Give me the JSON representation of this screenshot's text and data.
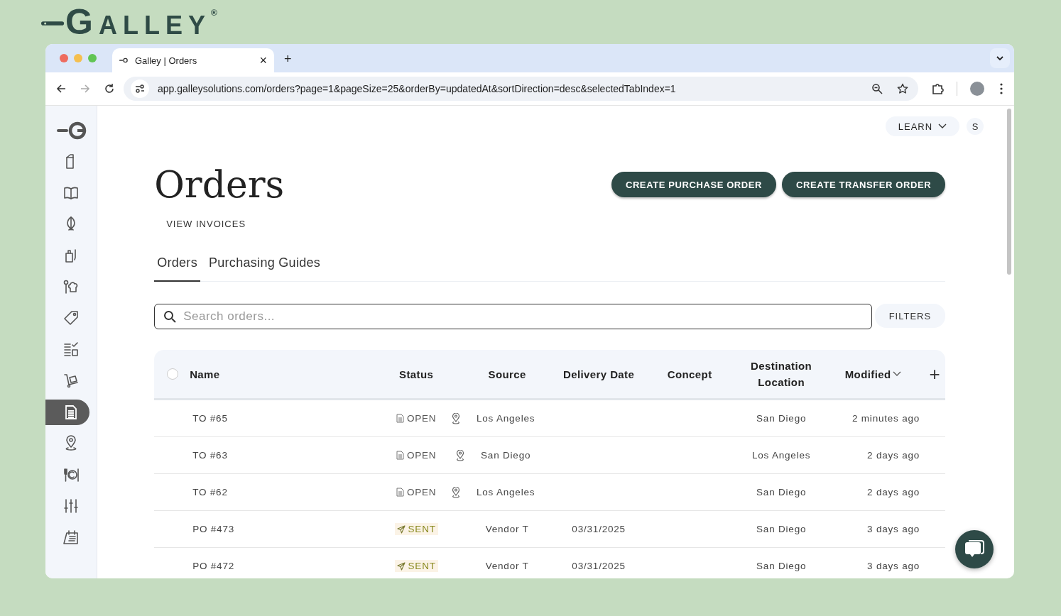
{
  "brand": {
    "text": "GALLEY",
    "mark": "®"
  },
  "browser": {
    "tab": {
      "title": "Galley | Orders",
      "close": "×"
    },
    "new_tab": "+",
    "url": "app.galleysolutions.com/orders?page=1&pageSize=25&orderBy=updatedAt&sortDirection=desc&selectedTabIndex=1"
  },
  "sidebar": {
    "items": [
      {
        "selected": false
      },
      {
        "selected": false
      },
      {
        "selected": false
      },
      {
        "selected": false
      },
      {
        "selected": false
      },
      {
        "selected": false
      },
      {
        "selected": false
      },
      {
        "selected": false
      },
      {
        "selected": true
      },
      {
        "selected": false
      },
      {
        "selected": false
      },
      {
        "selected": false
      },
      {
        "selected": false
      }
    ]
  },
  "topbar": {
    "learn": "LEARN",
    "avatar": "S"
  },
  "page": {
    "title": "Orders",
    "link": "VIEW INVOICES",
    "buttons": [
      "CREATE PURCHASE ORDER",
      "CREATE TRANSFER ORDER"
    ]
  },
  "tabs": [
    {
      "label": "Orders",
      "selected": true
    },
    {
      "label": "Purchasing Guides",
      "selected": false
    }
  ],
  "search": {
    "placeholder": "Search orders...",
    "filters": "FILTERS"
  },
  "table": {
    "select_all": {
      "checked": false
    },
    "columns": [
      "Name",
      "Status",
      "Source",
      "Delivery Date",
      "Concept",
      "Destination Location",
      "Modified"
    ],
    "add": "+",
    "rows": [
      {
        "name": "TO #65",
        "status": {
          "label": "OPEN",
          "kind": "open"
        },
        "source": {
          "text": "Los Angeles",
          "kind": "location"
        },
        "delivery_date": "",
        "destination": "San Diego",
        "modified": "2 minutes ago"
      },
      {
        "name": "TO #63",
        "status": {
          "label": "OPEN",
          "kind": "open"
        },
        "source": {
          "text": "San Diego",
          "kind": "location"
        },
        "delivery_date": "",
        "destination": "Los Angeles",
        "modified": "2 days ago"
      },
      {
        "name": "TO #62",
        "status": {
          "label": "OPEN",
          "kind": "open"
        },
        "source": {
          "text": "Los Angeles",
          "kind": "location"
        },
        "delivery_date": "",
        "destination": "San Diego",
        "modified": "2 days ago"
      },
      {
        "name": "PO #473",
        "status": {
          "label": "SENT",
          "kind": "sent"
        },
        "source": {
          "text": "Vendor T",
          "kind": "vendor"
        },
        "delivery_date": "03/31/2025",
        "destination": "San Diego",
        "modified": "3 days ago"
      },
      {
        "name": "PO #472",
        "status": {
          "label": "SENT",
          "kind": "sent"
        },
        "source": {
          "text": "Vendor T",
          "kind": "vendor"
        },
        "delivery_date": "03/31/2025",
        "destination": "San Diego",
        "modified": "3 days ago"
      }
    ]
  }
}
